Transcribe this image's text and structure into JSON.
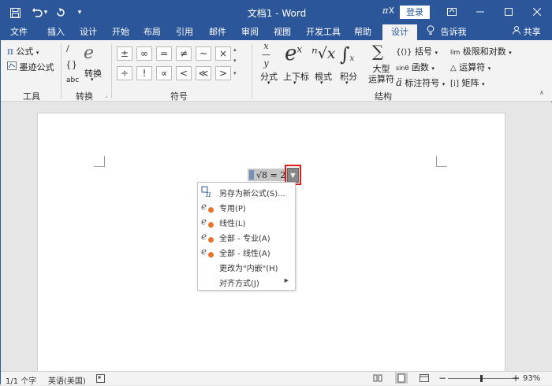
{
  "titlebar": {
    "title": "文档1 - Word",
    "login_label": "登录",
    "qat_undo_arrow": "▾",
    "qat_customize": "▾"
  },
  "tabs": [
    {
      "label": "文件"
    },
    {
      "label": "插入"
    },
    {
      "label": "设计"
    },
    {
      "label": "开始"
    },
    {
      "label": "布局"
    },
    {
      "label": "引用"
    },
    {
      "label": "邮件"
    },
    {
      "label": "审阅"
    },
    {
      "label": "视图"
    },
    {
      "label": "开发工具"
    },
    {
      "label": "帮助"
    },
    {
      "label": "设计",
      "active": true
    }
  ],
  "tell_me": "告诉我",
  "share": "共享",
  "ribbon": {
    "tools": {
      "equation": "公式",
      "ink_equation": "墨迹公式",
      "group_label": "工具"
    },
    "conversions": {
      "convert": "转换",
      "abc": "abc",
      "group_label": "转换"
    },
    "symbols": {
      "row1": [
        "±",
        "∞",
        "=",
        "≠",
        "~",
        "×"
      ],
      "row2": [
        "÷",
        "!",
        "∝",
        "<",
        "≪",
        ">"
      ],
      "group_label": "符号"
    },
    "structures": {
      "fraction": "分式",
      "script": "上下标",
      "radical": "根式",
      "integral": "积分",
      "large_operator_1": "大型",
      "large_operator_2": "运算符",
      "bracket": "括号",
      "function": "函数",
      "accent": "标注符号",
      "limit": "极限和对数",
      "operator": "运算符",
      "matrix": "矩阵",
      "group_label": "结构"
    }
  },
  "equation": {
    "text": "√8 = 2"
  },
  "context_menu": {
    "items": [
      {
        "label": "另存为新公式(S)...",
        "icon": "save-equation-icon"
      },
      {
        "label": "专用(P)",
        "icon": "professional-icon"
      },
      {
        "label": "线性(L)",
        "icon": "linear-icon"
      },
      {
        "label": "全部 - 专业(A)",
        "icon": "all-professional-icon"
      },
      {
        "label": "全部 - 线性(A)",
        "icon": "all-linear-icon"
      },
      {
        "label": "更改为\"内嵌\"(H)",
        "icon": ""
      },
      {
        "label": "对齐方式(J)",
        "icon": "",
        "submenu": true
      }
    ]
  },
  "status": {
    "page": "1/1 个字",
    "language": "英语(美国)",
    "zoom": "93%",
    "zoom_level": 0.93
  },
  "colors": {
    "brand": "#2b579a",
    "highlight_box": "#e21b1b"
  }
}
